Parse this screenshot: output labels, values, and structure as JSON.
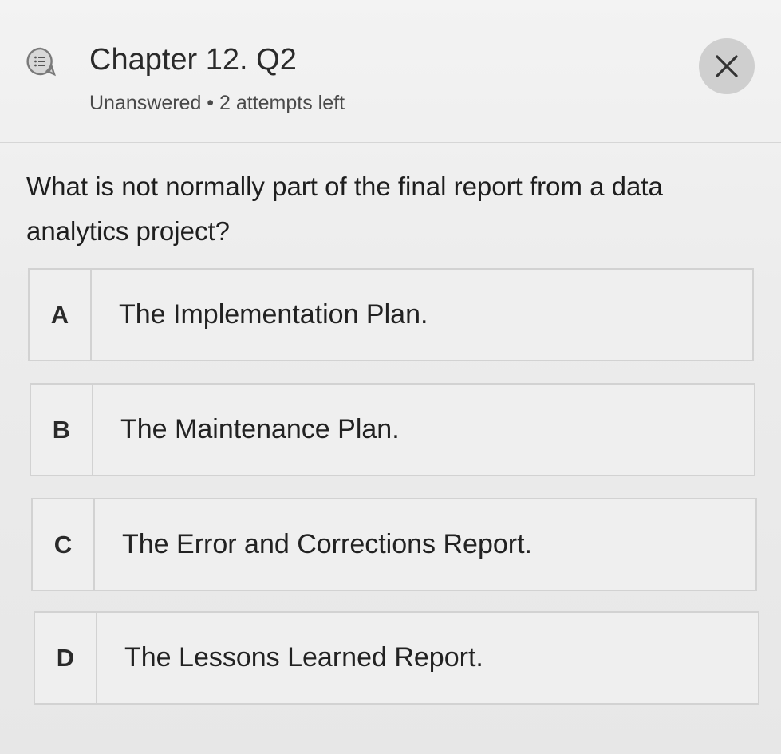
{
  "header": {
    "title": "Chapter 12. Q2",
    "subtitle": "Unanswered • 2 attempts left",
    "quiz_icon": "quiz-list-icon",
    "close_icon": "close-icon",
    "close_symbol": "✕"
  },
  "question": {
    "text": "What is not normally part of the final report from a data analytics project?"
  },
  "options": [
    {
      "letter": "A",
      "text": "The Implementation Plan."
    },
    {
      "letter": "B",
      "text": "The Maintenance Plan."
    },
    {
      "letter": "C",
      "text": "The Error and Corrections Report."
    },
    {
      "letter": "D",
      "text": "The Lessons Learned Report."
    }
  ],
  "colors": {
    "background": "#ececec",
    "close_button": "#cfcfcf",
    "border": "#d2d2d2",
    "text": "#1f1f1f"
  }
}
